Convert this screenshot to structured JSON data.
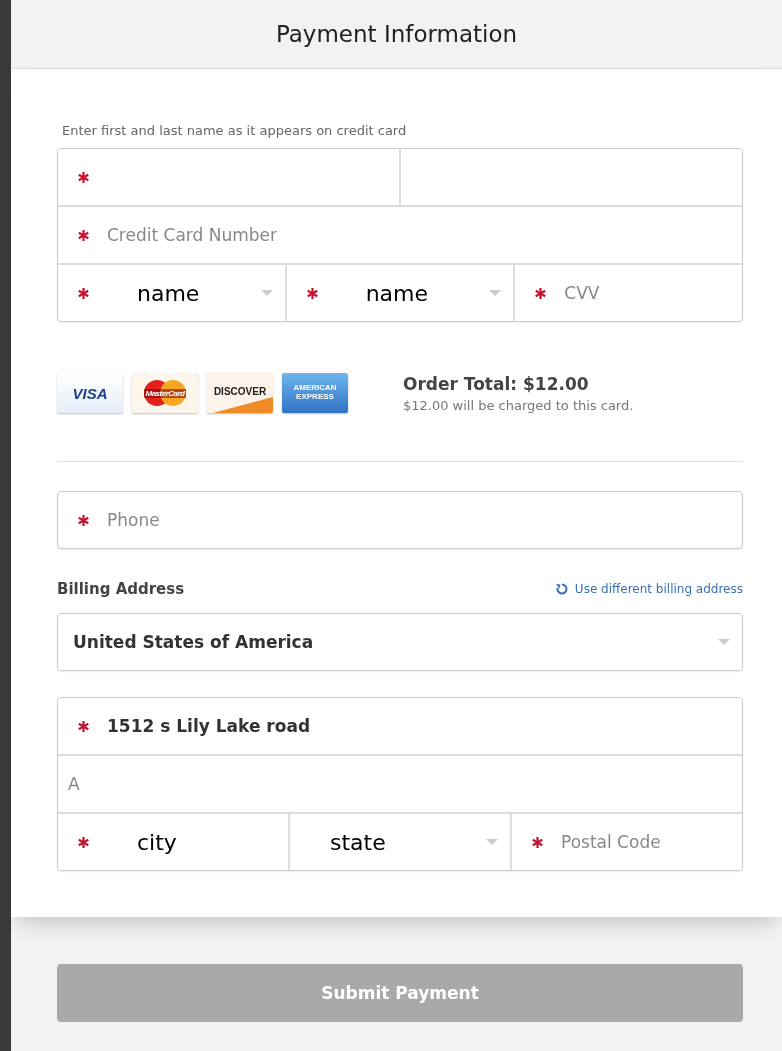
{
  "header": {
    "title": "Payment Information"
  },
  "card_section": {
    "hint": "Enter first and last name as it appears on credit card",
    "rows": [
      [
        {
          "kind": "input",
          "required": true
        },
        {
          "kind": "input",
          "required": false
        }
      ],
      [
        {
          "kind": "input",
          "required": true,
          "placeholder": "Credit Card Number"
        }
      ],
      [
        {
          "kind": "select",
          "required": true,
          "value": "name"
        },
        {
          "kind": "select",
          "required": true,
          "value": "name"
        },
        {
          "kind": "input",
          "required": true,
          "placeholder": "CVV"
        }
      ]
    ]
  },
  "card_logos": [
    {
      "kind": "visa",
      "label": "VISA"
    },
    {
      "kind": "mastercard",
      "label": "MasterCard"
    },
    {
      "kind": "discover",
      "label": "DISCOVER"
    },
    {
      "kind": "amex",
      "label": "AMERICAN EXPRESS"
    }
  ],
  "order": {
    "total": "Order Total: $12.00",
    "note": "$12.00 will be charged to this card."
  },
  "phone": {
    "required": true,
    "placeholder": "Phone"
  },
  "billing": {
    "label": "Billing Address",
    "link": "Use different billing address",
    "country": {
      "kind": "select",
      "required": false,
      "value": "United States of America"
    },
    "rows": [
      [
        {
          "kind": "input",
          "required": true,
          "value": "1512 s Lily Lake road"
        }
      ],
      [
        {
          "kind": "input",
          "required": false,
          "placeholder": "A"
        }
      ],
      [
        {
          "kind": "input",
          "required": true,
          "value": "city"
        },
        {
          "kind": "select",
          "required": false,
          "value": "state"
        },
        {
          "kind": "input",
          "required": true,
          "placeholder": "Postal Code"
        }
      ]
    ]
  },
  "submit": {
    "label": "Submit Payment",
    "disabled": true
  }
}
